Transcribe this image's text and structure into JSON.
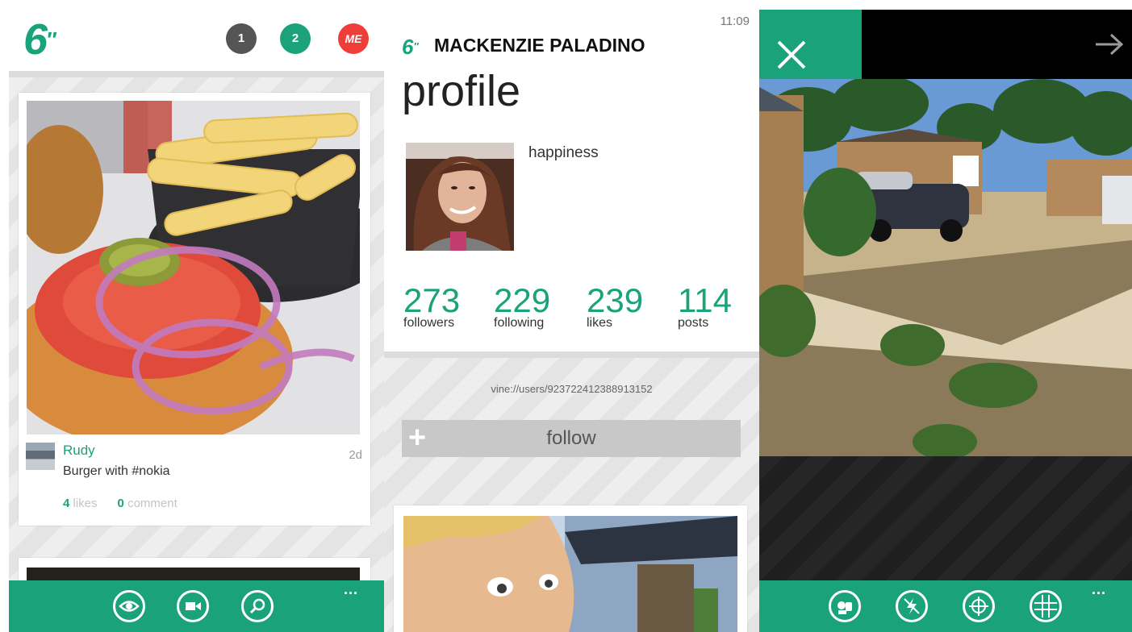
{
  "feed": {
    "logo": "6",
    "logo_mark": "″",
    "badges": [
      "1",
      "2",
      "ME"
    ],
    "post": {
      "username": "Rudy",
      "age": "2d",
      "caption": "Burger with #nokia",
      "likes_count": "4",
      "likes_label": "likes",
      "comments_count": "0",
      "comments_label": "comment"
    },
    "appbar": {
      "icons": [
        "eye-icon",
        "video-camera-icon",
        "search-icon"
      ],
      "more": "..."
    }
  },
  "profile": {
    "time": "11:09",
    "logo": "6",
    "logo_mark": "″",
    "user_name": "MACKENZIE PALADINO",
    "title": "profile",
    "bio": "happiness",
    "stats": [
      {
        "value": "273",
        "label": "followers"
      },
      {
        "value": "229",
        "label": "following"
      },
      {
        "value": "239",
        "label": "likes"
      },
      {
        "value": "114",
        "label": "posts"
      }
    ],
    "uri": "vine://users/923722412388913152",
    "follow_label": "follow",
    "follow_icon": "+"
  },
  "camera": {
    "close_icon": "close-icon",
    "next_icon": "arrow-right-icon",
    "appbar": {
      "icons": [
        "switch-camera-icon",
        "flash-off-icon",
        "focus-icon",
        "grid-icon"
      ],
      "more": "..."
    }
  },
  "colors": {
    "accent": "#1aa37a",
    "red_badge": "#ef3e3a",
    "gray_badge": "#555555"
  }
}
